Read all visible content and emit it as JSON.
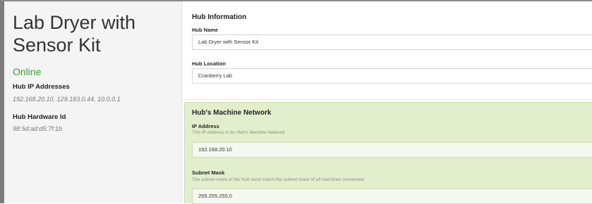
{
  "hub": {
    "title": "Lab Dryer with Sensor Kit",
    "status": "Online",
    "ip_label": "Hub IP Addresses",
    "ip_value": "192.168.20.10, 129.183.0.44, 10.0.0.1",
    "hwid_label": "Hub Hardware Id",
    "hwid_value": "98:5d:ad:d5:7f:1b"
  },
  "info": {
    "section_title": "Hub Information",
    "name_label": "Hub Name",
    "name_value": "Lab Dryer with Sensor Kit",
    "location_label": "Hub Location",
    "location_value": "Cranberry Lab"
  },
  "network": {
    "section_title": "Hub's Machine Network",
    "ip_label": "IP Address",
    "ip_hint": "This IP Address is for Hub's Machine Network",
    "ip_value": "192.168.20.10",
    "subnet_label": "Subnet Mask",
    "subnet_hint": "The subnet mask of the Hub must match the subnet mask of all machines connected.",
    "subnet_value": "255.255.255.0"
  },
  "colors": {
    "online": "#31a531",
    "network_bg": "#e3efcc",
    "sidebar_bg": "#f4f4f4"
  }
}
